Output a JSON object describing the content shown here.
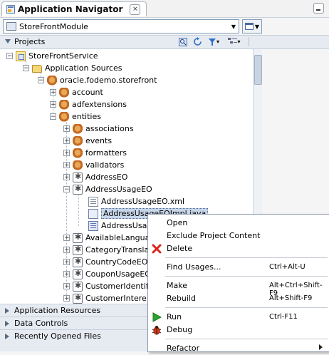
{
  "window": {
    "title": "Application Navigator",
    "close_glyph": "×"
  },
  "module_selector": {
    "selected": "StoreFrontModule",
    "arrow": "▼",
    "button_arrow": "▼"
  },
  "projects": {
    "label": "Projects",
    "toolbar": {
      "search": "🔍",
      "sync": "⟳",
      "filter": "▾",
      "sort": "▾"
    }
  },
  "tree": {
    "project": "StoreFrontService",
    "application_sources": "Application Sources",
    "package": "oracle.fodemo.storefront",
    "account": "account",
    "adfextensions": "adfextensions",
    "entities": "entities",
    "associations": "associations",
    "events": "events",
    "formatters": "formatters",
    "validators": "validators",
    "address_eo": "AddressEO",
    "address_usage_eo": "AddressUsageEO",
    "address_usage_eo_xml": "AddressUsageEO.xml",
    "address_usage_eo_impl": "AddressUsageEOImpl.java",
    "address_usage_extra": "AddressUsag",
    "available_languages": "AvailableLanguag",
    "category_translations": "CategoryTransla",
    "country_code_eo": "CountryCodeEO",
    "coupon_usage_eo": "CouponUsageEO",
    "customer_identification": "CustomerIdentifi",
    "customer_interests": "CustomerIntere",
    "expand_glyph": "+",
    "collapse_glyph": "−"
  },
  "panels": {
    "application_resources": "Application Resources",
    "data_controls": "Data Controls",
    "recently_opened": "Recently Opened Files"
  },
  "context_menu": {
    "open": "Open",
    "exclude": "Exclude Project Content",
    "delete": "Delete",
    "find_usages": "Find Usages...",
    "find_usages_key": "Ctrl+Alt-U",
    "make": "Make",
    "make_key": "Alt+Ctrl+Shift-F9",
    "rebuild": "Rebuild",
    "rebuild_key": "Alt+Shift-F9",
    "run": "Run",
    "run_key": "Ctrl-F11",
    "debug": "Debug",
    "refactor": "Refactor"
  },
  "colors": {
    "accent": "#c8d6ea",
    "delete": "#d9251d",
    "run": "#2aa52a",
    "debug": "#d63a1a"
  }
}
